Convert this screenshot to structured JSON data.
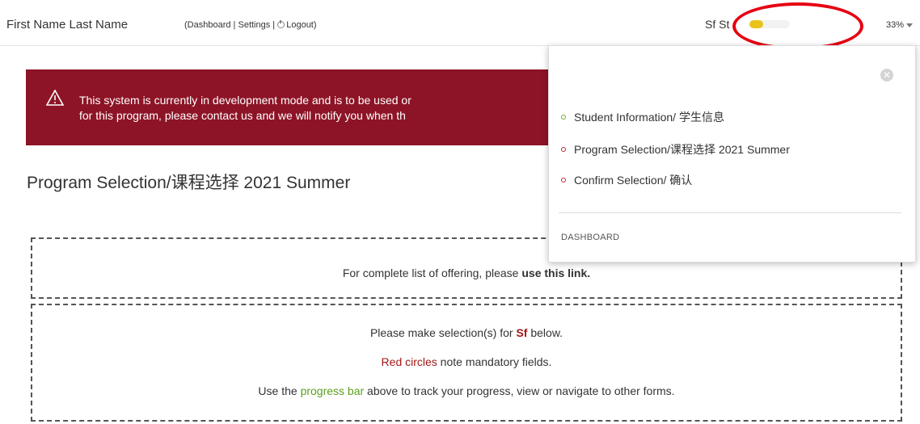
{
  "header": {
    "user_name": "First Name Last Name",
    "nav_open": "(",
    "nav_dashboard": "Dashboard",
    "nav_sep1": " | ",
    "nav_settings": "Settings",
    "nav_sep2": " | ",
    "nav_logout": "Logout",
    "nav_close": ")",
    "student_short": "Sf St",
    "progress_value": 0.33,
    "progress_percent": "33%",
    "progress_color": "#e9c21a"
  },
  "alert": {
    "line1": "This system is currently in development mode and is to be used or",
    "line2": "for this program, please contact us and we will notify you when th",
    "color": "#8d1426"
  },
  "page": {
    "title": "Program Selection/课程选择 2021 Summer"
  },
  "info_box": {
    "text_before": "For complete list of offering, please ",
    "link_text": "use this link."
  },
  "instructions": {
    "line1_before": "Please make selection(s) for ",
    "line1_name": "Sf",
    "line1_after": " below.",
    "line2_highlight": "Red circles",
    "line2_after": " note mandatory fields.",
    "line3_before": "Use the ",
    "line3_highlight": "progress bar",
    "line3_after": " above to track your progress, view or navigate to other forms."
  },
  "dropdown": {
    "close_icon": "close-icon",
    "items": [
      {
        "label": "Student Information/ 学生信息",
        "status": "complete"
      },
      {
        "label": "Program Selection/课程选择 2021 Summer",
        "status": "incomplete"
      },
      {
        "label": "Confirm Selection/ 确认",
        "status": "incomplete"
      }
    ],
    "footer": "DASHBOARD"
  }
}
